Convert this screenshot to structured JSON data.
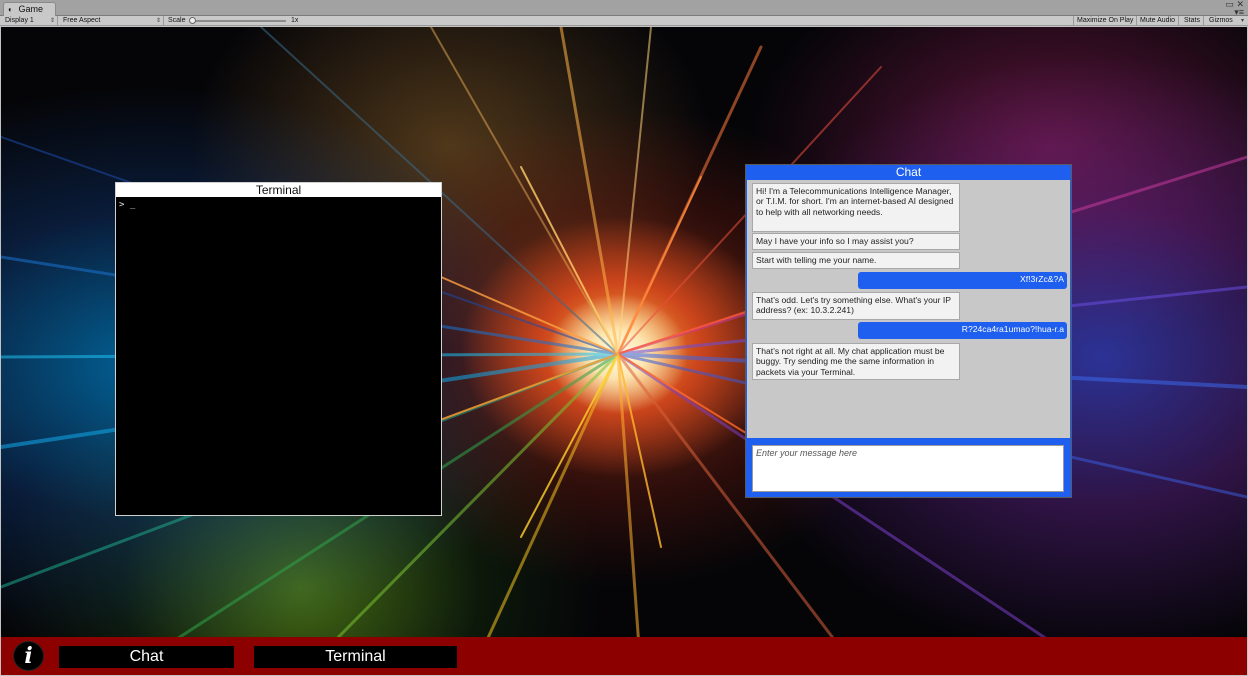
{
  "editor": {
    "tab_label": "Game",
    "tab_icon": "game-controller-icon",
    "window_controls": {
      "maximize": "▭",
      "close": "✕",
      "menu": "▾≡"
    },
    "display_label": "Display 1",
    "aspect_label": "Free Aspect",
    "scale_label": "Scale",
    "scale_value": "1x",
    "maximize_label": "Maximize On Play",
    "mute_label": "Mute Audio",
    "stats_label": "Stats",
    "gizmos_label": "Gizmos"
  },
  "terminal": {
    "title": "Terminal",
    "prompt": "> _"
  },
  "chat": {
    "title": "Chat",
    "messages": [
      {
        "sender": "bot",
        "text": "Hi! I'm a Telecommunications Intelligence Manager, or T.I.M. for short. I'm an internet-based AI designed to help with all networking needs."
      },
      {
        "sender": "bot",
        "text": "May I have your info so I may assist you?"
      },
      {
        "sender": "bot",
        "text": "Start with telling me your name."
      },
      {
        "sender": "user",
        "text": "Xf!3rZc&?A"
      },
      {
        "sender": "bot",
        "text": "That's odd. Let's try something else. What's your IP address? (ex: 10.3.2.241)"
      },
      {
        "sender": "user",
        "text": "R?24ca4ra1umao?!hua-r.a"
      },
      {
        "sender": "bot",
        "text": "That's not right at all. My chat application must be buggy. Try sending me the same information in packets via your Terminal."
      }
    ],
    "input_placeholder": "Enter your message here"
  },
  "taskbar": {
    "info_icon": "info-icon",
    "info_glyph": "i",
    "chat_label": "Chat",
    "terminal_label": "Terminal"
  },
  "colors": {
    "chat_blue": "#1e5ff0",
    "taskbar_red": "#8c0000",
    "terminal_bg": "#000000"
  }
}
